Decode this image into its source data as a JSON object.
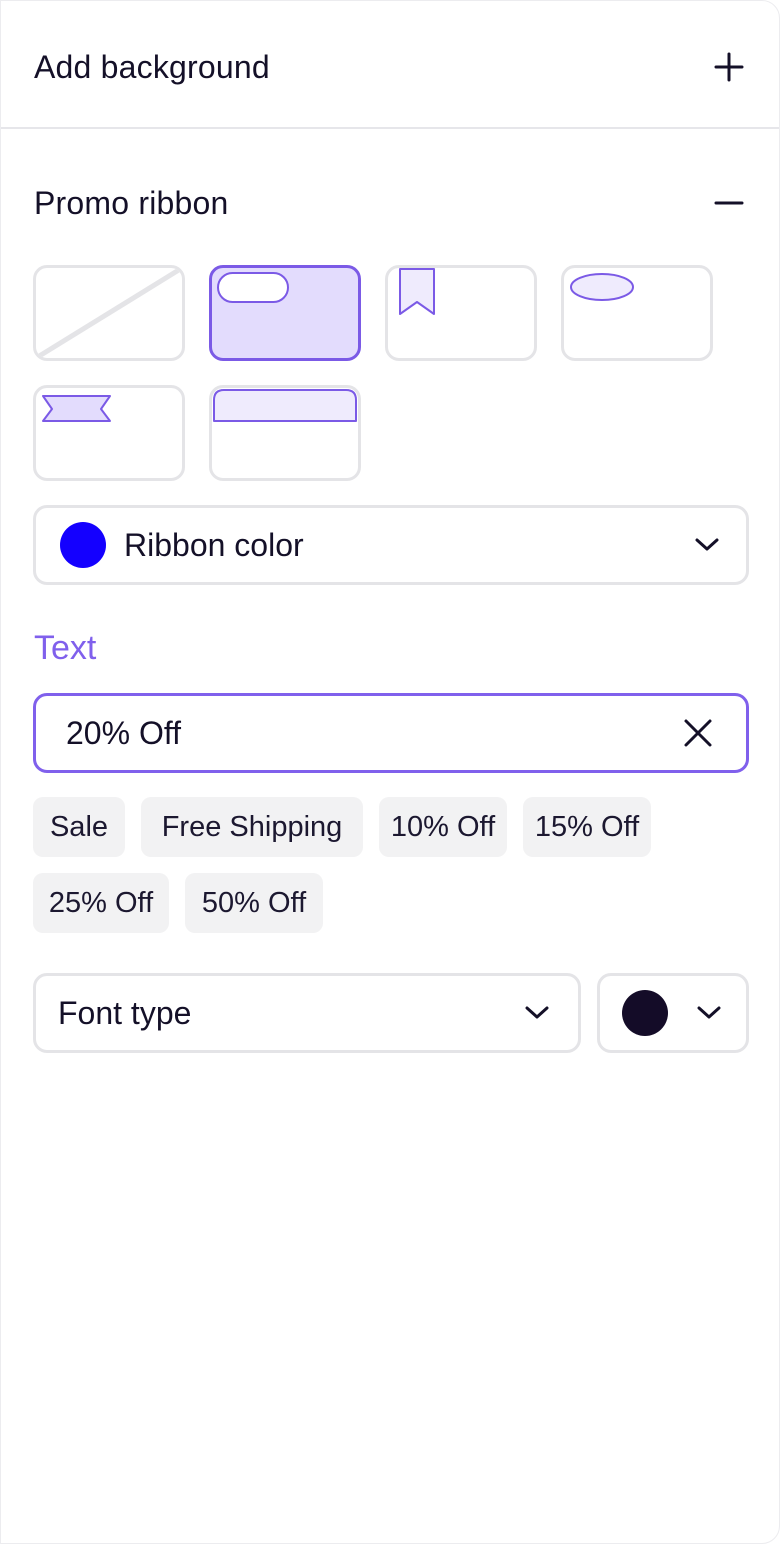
{
  "background_section": {
    "title": "Add background",
    "toggle_icon": "plus-icon"
  },
  "promo_section": {
    "title": "Promo ribbon",
    "toggle_icon": "minus-icon",
    "styles": [
      {
        "name": "none",
        "selected": false
      },
      {
        "name": "pill",
        "selected": true
      },
      {
        "name": "bookmark",
        "selected": false
      },
      {
        "name": "oval",
        "selected": false
      },
      {
        "name": "banner",
        "selected": false
      },
      {
        "name": "full-width-tab",
        "selected": false
      }
    ],
    "ribbon_color": {
      "label": "Ribbon color",
      "color": "#1400ff",
      "icon": "chevron-down-icon"
    },
    "text": {
      "heading": "Text",
      "value": "20% Off",
      "clear_icon": "close-icon",
      "suggestions": [
        "Sale",
        "Free Shipping",
        "10% Off",
        "15% Off",
        "25% Off",
        "50% Off"
      ]
    },
    "font_type": {
      "label": "Font type",
      "icon": "chevron-down-icon"
    },
    "font_color": {
      "color": "#140c28",
      "icon": "chevron-down-icon"
    }
  },
  "colors": {
    "accent": "#8060ec",
    "selected_fill": "#e3dcfd",
    "border": "#e4e4e7",
    "chip_bg": "#f2f2f3"
  }
}
